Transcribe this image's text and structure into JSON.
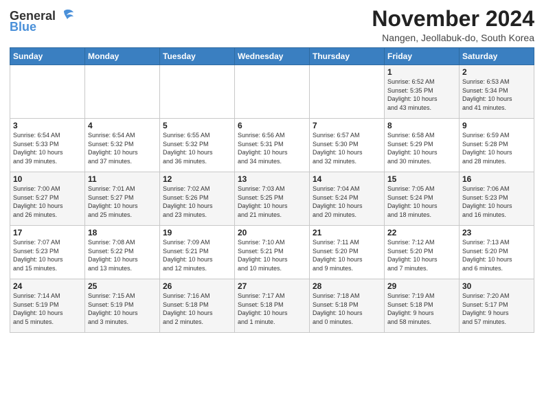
{
  "header": {
    "logo_line1": "General",
    "logo_line2": "Blue",
    "month_title": "November 2024",
    "subtitle": "Nangen, Jeollabuk-do, South Korea"
  },
  "days_of_week": [
    "Sunday",
    "Monday",
    "Tuesday",
    "Wednesday",
    "Thursday",
    "Friday",
    "Saturday"
  ],
  "weeks": [
    [
      {
        "day": "",
        "info": ""
      },
      {
        "day": "",
        "info": ""
      },
      {
        "day": "",
        "info": ""
      },
      {
        "day": "",
        "info": ""
      },
      {
        "day": "",
        "info": ""
      },
      {
        "day": "1",
        "info": "Sunrise: 6:52 AM\nSunset: 5:35 PM\nDaylight: 10 hours\nand 43 minutes."
      },
      {
        "day": "2",
        "info": "Sunrise: 6:53 AM\nSunset: 5:34 PM\nDaylight: 10 hours\nand 41 minutes."
      }
    ],
    [
      {
        "day": "3",
        "info": "Sunrise: 6:54 AM\nSunset: 5:33 PM\nDaylight: 10 hours\nand 39 minutes."
      },
      {
        "day": "4",
        "info": "Sunrise: 6:54 AM\nSunset: 5:32 PM\nDaylight: 10 hours\nand 37 minutes."
      },
      {
        "day": "5",
        "info": "Sunrise: 6:55 AM\nSunset: 5:32 PM\nDaylight: 10 hours\nand 36 minutes."
      },
      {
        "day": "6",
        "info": "Sunrise: 6:56 AM\nSunset: 5:31 PM\nDaylight: 10 hours\nand 34 minutes."
      },
      {
        "day": "7",
        "info": "Sunrise: 6:57 AM\nSunset: 5:30 PM\nDaylight: 10 hours\nand 32 minutes."
      },
      {
        "day": "8",
        "info": "Sunrise: 6:58 AM\nSunset: 5:29 PM\nDaylight: 10 hours\nand 30 minutes."
      },
      {
        "day": "9",
        "info": "Sunrise: 6:59 AM\nSunset: 5:28 PM\nDaylight: 10 hours\nand 28 minutes."
      }
    ],
    [
      {
        "day": "10",
        "info": "Sunrise: 7:00 AM\nSunset: 5:27 PM\nDaylight: 10 hours\nand 26 minutes."
      },
      {
        "day": "11",
        "info": "Sunrise: 7:01 AM\nSunset: 5:27 PM\nDaylight: 10 hours\nand 25 minutes."
      },
      {
        "day": "12",
        "info": "Sunrise: 7:02 AM\nSunset: 5:26 PM\nDaylight: 10 hours\nand 23 minutes."
      },
      {
        "day": "13",
        "info": "Sunrise: 7:03 AM\nSunset: 5:25 PM\nDaylight: 10 hours\nand 21 minutes."
      },
      {
        "day": "14",
        "info": "Sunrise: 7:04 AM\nSunset: 5:24 PM\nDaylight: 10 hours\nand 20 minutes."
      },
      {
        "day": "15",
        "info": "Sunrise: 7:05 AM\nSunset: 5:24 PM\nDaylight: 10 hours\nand 18 minutes."
      },
      {
        "day": "16",
        "info": "Sunrise: 7:06 AM\nSunset: 5:23 PM\nDaylight: 10 hours\nand 16 minutes."
      }
    ],
    [
      {
        "day": "17",
        "info": "Sunrise: 7:07 AM\nSunset: 5:23 PM\nDaylight: 10 hours\nand 15 minutes."
      },
      {
        "day": "18",
        "info": "Sunrise: 7:08 AM\nSunset: 5:22 PM\nDaylight: 10 hours\nand 13 minutes."
      },
      {
        "day": "19",
        "info": "Sunrise: 7:09 AM\nSunset: 5:21 PM\nDaylight: 10 hours\nand 12 minutes."
      },
      {
        "day": "20",
        "info": "Sunrise: 7:10 AM\nSunset: 5:21 PM\nDaylight: 10 hours\nand 10 minutes."
      },
      {
        "day": "21",
        "info": "Sunrise: 7:11 AM\nSunset: 5:20 PM\nDaylight: 10 hours\nand 9 minutes."
      },
      {
        "day": "22",
        "info": "Sunrise: 7:12 AM\nSunset: 5:20 PM\nDaylight: 10 hours\nand 7 minutes."
      },
      {
        "day": "23",
        "info": "Sunrise: 7:13 AM\nSunset: 5:20 PM\nDaylight: 10 hours\nand 6 minutes."
      }
    ],
    [
      {
        "day": "24",
        "info": "Sunrise: 7:14 AM\nSunset: 5:19 PM\nDaylight: 10 hours\nand 5 minutes."
      },
      {
        "day": "25",
        "info": "Sunrise: 7:15 AM\nSunset: 5:19 PM\nDaylight: 10 hours\nand 3 minutes."
      },
      {
        "day": "26",
        "info": "Sunrise: 7:16 AM\nSunset: 5:18 PM\nDaylight: 10 hours\nand 2 minutes."
      },
      {
        "day": "27",
        "info": "Sunrise: 7:17 AM\nSunset: 5:18 PM\nDaylight: 10 hours\nand 1 minute."
      },
      {
        "day": "28",
        "info": "Sunrise: 7:18 AM\nSunset: 5:18 PM\nDaylight: 10 hours\nand 0 minutes."
      },
      {
        "day": "29",
        "info": "Sunrise: 7:19 AM\nSunset: 5:18 PM\nDaylight: 9 hours\nand 58 minutes."
      },
      {
        "day": "30",
        "info": "Sunrise: 7:20 AM\nSunset: 5:17 PM\nDaylight: 9 hours\nand 57 minutes."
      }
    ]
  ]
}
